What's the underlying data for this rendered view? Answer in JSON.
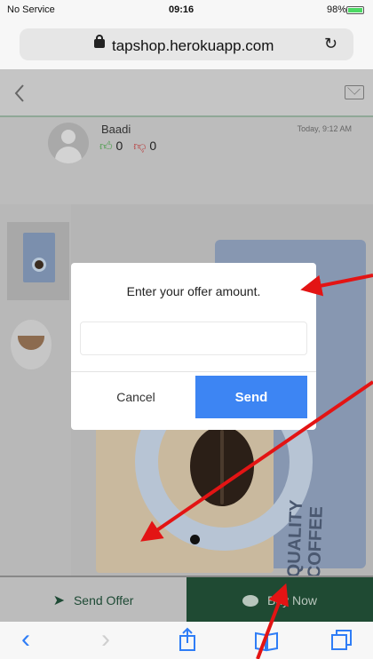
{
  "status_bar": {
    "carrier": "No Service",
    "time": "09:16",
    "battery": "98%",
    "battery_level": 0.98
  },
  "browser": {
    "url": "tapshop.herokuapp.com",
    "lock_icon": "lock-icon",
    "reload_icon": "reload-icon"
  },
  "header": {
    "back_icon": "chevron-left-icon",
    "mail_icon": "envelope-icon"
  },
  "message": {
    "user_name": "Baadi",
    "likes": "0",
    "dislikes": "0",
    "timestamp": "Today, 9:12 AM"
  },
  "product": {
    "side_text": "QUALITY COFFEE"
  },
  "modal": {
    "title": "Enter your offer amount.",
    "input_value": "",
    "input_placeholder": "",
    "cancel_label": "Cancel",
    "send_label": "Send",
    "send_color": "#3d85f3"
  },
  "actions": {
    "send_offer_label": "Send Offer",
    "buy_now_label": "Buy Now",
    "buy_now_color": "#1f4a33"
  },
  "toolbar": {
    "back_icon": "chevron-left-icon",
    "forward_icon": "chevron-right-icon",
    "share_icon": "share-icon",
    "bookmarks_icon": "book-icon",
    "tabs_icon": "tabs-icon"
  },
  "annotation_color": "#e31414"
}
